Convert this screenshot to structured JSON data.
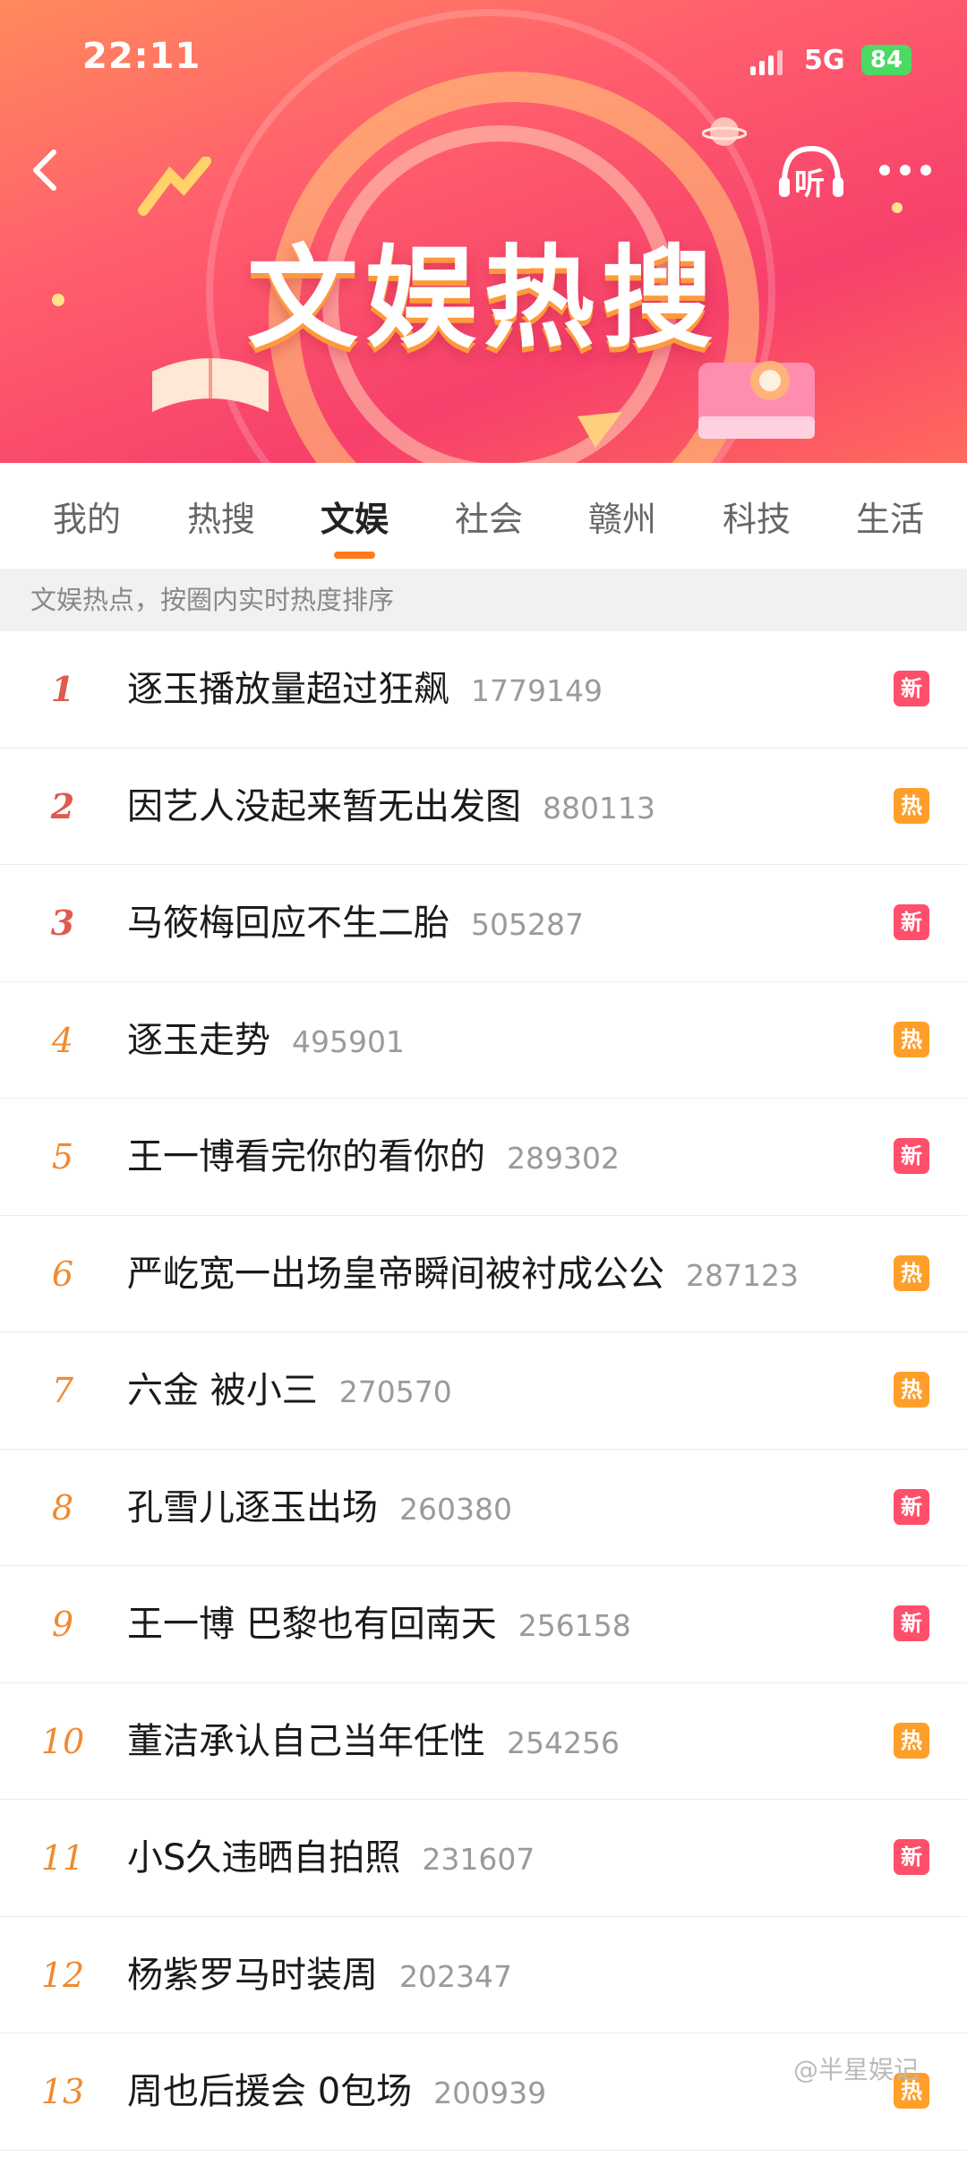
{
  "status_bar": {
    "time": "22:11",
    "network": "5G",
    "battery": "84"
  },
  "banner": {
    "title": "文娱热搜",
    "listen_label": "听"
  },
  "tabs": [
    {
      "label": "我的",
      "active": false
    },
    {
      "label": "热搜",
      "active": false
    },
    {
      "label": "文娱",
      "active": true
    },
    {
      "label": "社会",
      "active": false
    },
    {
      "label": "赣州",
      "active": false
    },
    {
      "label": "科技",
      "active": false
    },
    {
      "label": "生活",
      "active": false
    }
  ],
  "hint": "文娱热点，按圈内实时热度排序",
  "colors": {
    "rank_top": "#e05a4f",
    "rank_other": "#f08a2e",
    "badge_new": "#ff4f6b",
    "badge_hot": "#ff9f2a",
    "tab_indicator": "#ff7a1a"
  },
  "badge_labels": {
    "new": "新",
    "hot": "热"
  },
  "items": [
    {
      "rank": "1",
      "title": "逐玉播放量超过狂飙",
      "count": "1779149",
      "badge": "新",
      "badge_type": "new"
    },
    {
      "rank": "2",
      "title": "因艺人没起来暂无出发图",
      "count": "880113",
      "badge": "热",
      "badge_type": "hot"
    },
    {
      "rank": "3",
      "title": "马筱梅回应不生二胎",
      "count": "505287",
      "badge": "新",
      "badge_type": "new"
    },
    {
      "rank": "4",
      "title": "逐玉走势",
      "count": "495901",
      "badge": "热",
      "badge_type": "hot"
    },
    {
      "rank": "5",
      "title": "王一博看完你的看你的",
      "count": "289302",
      "badge": "新",
      "badge_type": "new"
    },
    {
      "rank": "6",
      "title": "严屹宽一出场皇帝瞬间被衬成公公",
      "count": "287123",
      "badge": "热",
      "badge_type": "hot"
    },
    {
      "rank": "7",
      "title": "六金 被小三",
      "count": "270570",
      "badge": "热",
      "badge_type": "hot"
    },
    {
      "rank": "8",
      "title": "孔雪儿逐玉出场",
      "count": "260380",
      "badge": "新",
      "badge_type": "new"
    },
    {
      "rank": "9",
      "title": "王一博 巴黎也有回南天",
      "count": "256158",
      "badge": "新",
      "badge_type": "new"
    },
    {
      "rank": "10",
      "title": "董洁承认自己当年任性",
      "count": "254256",
      "badge": "热",
      "badge_type": "hot"
    },
    {
      "rank": "11",
      "title": "小S久违晒自拍照",
      "count": "231607",
      "badge": "新",
      "badge_type": "new"
    },
    {
      "rank": "12",
      "title": "杨紫罗马时装周",
      "count": "202347",
      "badge": "",
      "badge_type": "none"
    },
    {
      "rank": "13",
      "title": "周也后援会 0包场",
      "count": "200939",
      "badge": "热",
      "badge_type": "hot"
    }
  ],
  "watermark": "@半星娱记"
}
